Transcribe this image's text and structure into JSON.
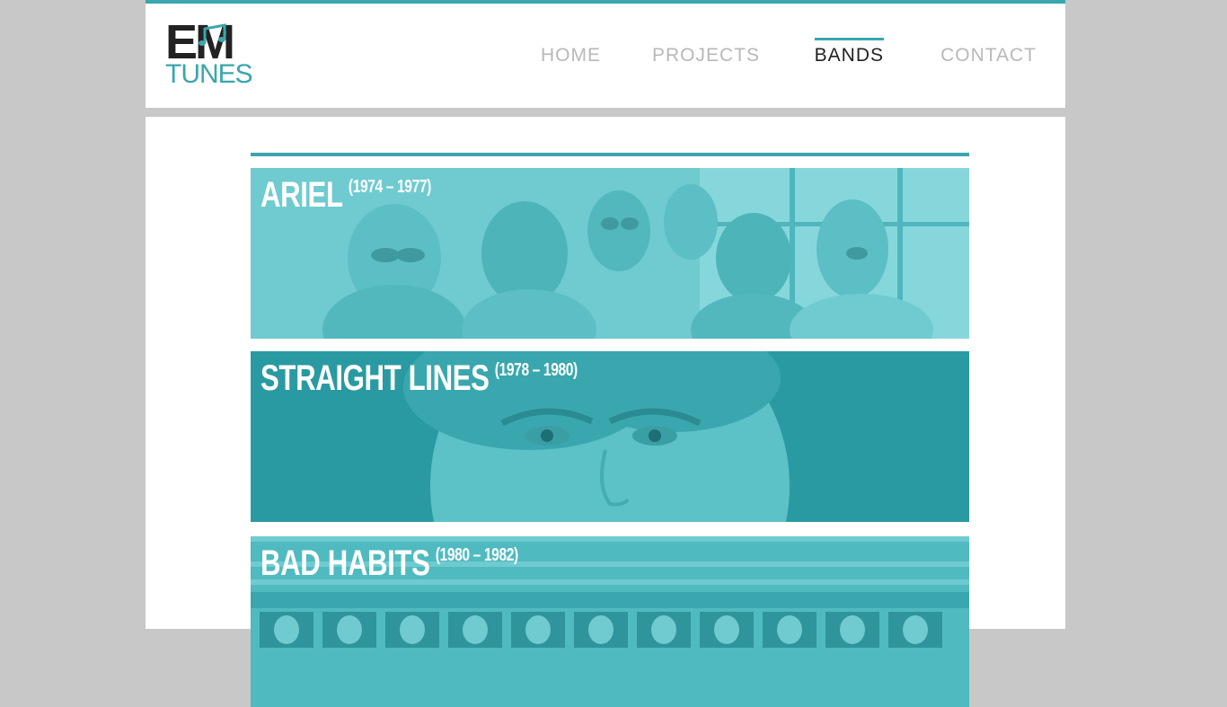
{
  "logo": {
    "line1": "EM",
    "line2": "TUNES"
  },
  "nav": {
    "items": [
      {
        "label": "HOME",
        "active": false
      },
      {
        "label": "PROJECTS",
        "active": false
      },
      {
        "label": "BANDS",
        "active": true
      },
      {
        "label": "CONTACT",
        "active": false
      }
    ]
  },
  "bands": [
    {
      "name": "ARIEL",
      "years": "(1974 – 1977)"
    },
    {
      "name": "STRAIGHT LINES",
      "years": "(1978 – 1980)"
    },
    {
      "name": "BAD HABITS",
      "years": "(1980 – 1982)"
    }
  ],
  "colors": {
    "accent": "#3aa6ad",
    "page_bg": "#c8c8c8"
  }
}
